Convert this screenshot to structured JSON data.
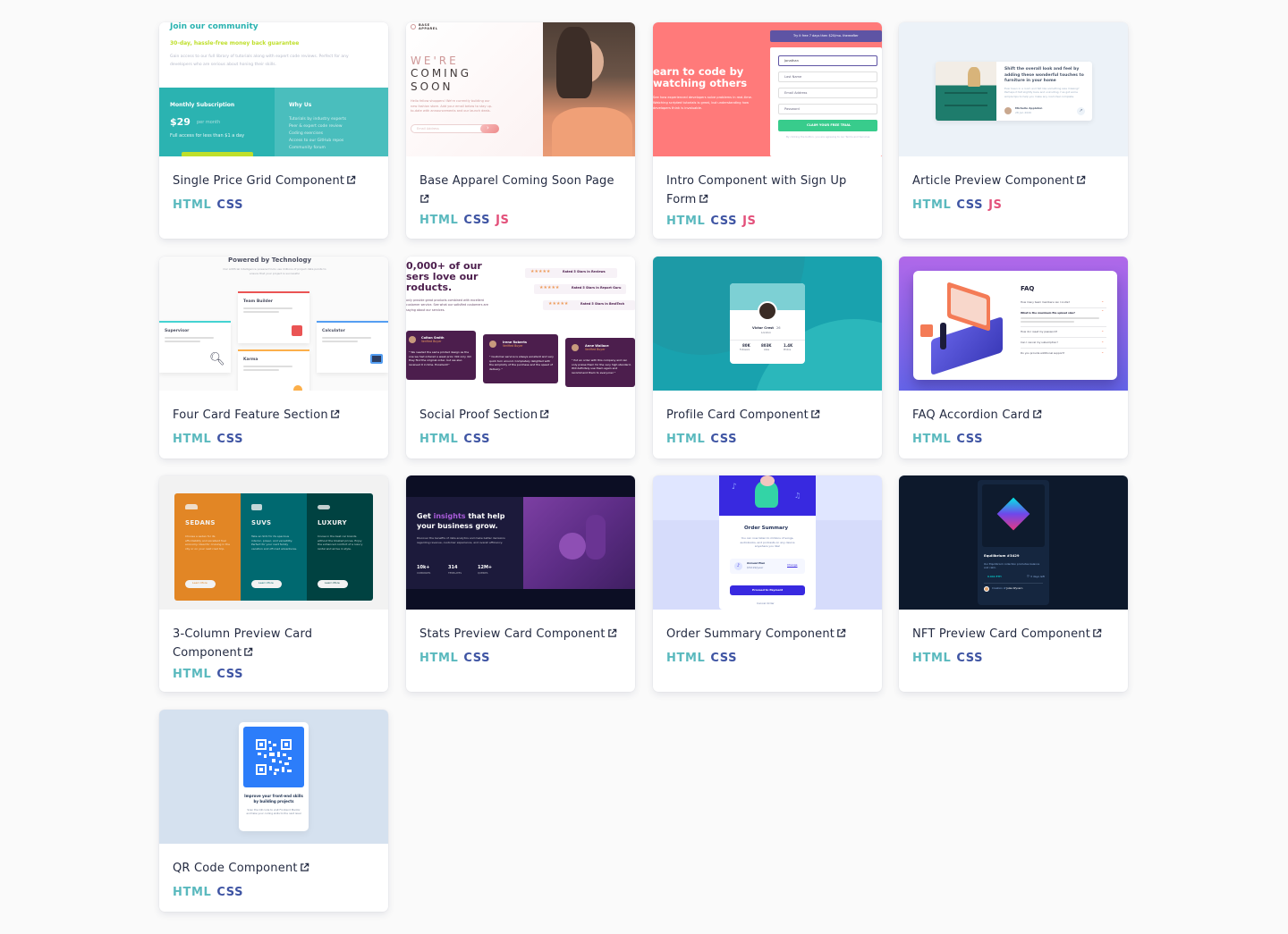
{
  "cards": [
    {
      "title": "Single Price Grid Component",
      "tags": [
        "HTML",
        "CSS"
      ],
      "preview": {
        "heading": "Join our community",
        "subheading": "30-day, hassle-free money back guarantee",
        "text": "Gain access to our full library of tutorials along with expert code reviews. Perfect for any developers who are serious about honing their skills.",
        "subscription_label": "Monthly Subscription",
        "price": "$29",
        "period": "per month",
        "price_note": "Full access for less than $1 a day",
        "why_title": "Why Us",
        "why_items": [
          "Tutorials by industry experts",
          "Peer & expert code review",
          "Coding exercises",
          "Access to our GitHub repos",
          "Community forum"
        ]
      }
    },
    {
      "title": "Base Apparel Coming Soon Page",
      "tags": [
        "HTML",
        "CSS",
        "JS"
      ],
      "preview": {
        "logo": "BASE APPAREL",
        "line1": "WE'RE",
        "line2": "COMING",
        "line3": "SOON",
        "text": "Hello fellow shoppers! We're currently building our new fashion store. Add your email below to stay up-to-date with announcements and our launch deals.",
        "email_placeholder": "Email Address"
      }
    },
    {
      "title": "Intro Component with Sign Up Form",
      "tags": [
        "HTML",
        "CSS",
        "JS"
      ],
      "preview": {
        "headline_line1": "earn to code by",
        "headline_line2": "watching others",
        "text": "See how experienced developers solve problems in real-time. Watching scripted tutorials is great, but understanding how developers think is invaluable.",
        "banner": "Try it free 7 days then $20/mo. thereafter",
        "field_1": "Jonathan",
        "field_2": "Last Name",
        "field_3": "Email Address",
        "field_4": "Password",
        "cta": "CLAIM YOUR FREE TRIAL",
        "terms": "By clicking the button, you are agreeing to our Terms and Services"
      }
    },
    {
      "title": "Article Preview Component",
      "tags": [
        "HTML",
        "CSS",
        "JS"
      ],
      "preview": {
        "headline": "Shift the overall look and feel by adding these wonderful touches to furniture in your home",
        "text": "Ever been in a room and felt like something was missing? Perhaps it felt slightly bare and uninviting. I've got some simple tips to help you make any room feel complete.",
        "author": "Michelle Appleton",
        "date": "28 Jun 2020"
      }
    },
    {
      "title": "Four Card Feature Section",
      "tags": [
        "HTML",
        "CSS"
      ],
      "preview": {
        "heading": "Powered by Technology",
        "text": "Our Artificial Intelligence powered tools use millions of project data points to ensure that your project is successful",
        "feature_1": "Supervisor",
        "feature_2": "Team Builder",
        "feature_3": "Karma",
        "feature_4": "Calculator"
      }
    },
    {
      "title": "Social Proof Section",
      "tags": [
        "HTML",
        "CSS"
      ],
      "preview": {
        "headline_line1": "0,000+ of our",
        "headline_line2": "sers love our",
        "headline_line3": "roducts.",
        "text": "only provide great products combined with excellent customer service. See what our satisfied customers are saying about our services.",
        "rating_1": "Rated 5 Stars in Reviews",
        "rating_2": "Rated 5 Stars in Report Guru",
        "rating_3": "Rated 5 Stars in BestTech",
        "reviewer_1": "Colton Smith",
        "reviewer_2": "Irene Roberts",
        "reviewer_3": "Anne Wallace",
        "verified": "Verified Buyer",
        "quote_1": "\" We needed the same printed design as the one we had ordered a week prior. Not only did they find the original order, but we also received it in time. Excellent!\"",
        "quote_2": "\" Customer service is always excellent and very quick turn around. Completely delighted with the simplicity of the purchase and the speed of delivery. \"",
        "quote_3": "\" Put an order with this company and can only praise them for the very high standard. Will definitely use them again and recommend them to everyone! \""
      }
    },
    {
      "title": "Profile Card Component",
      "tags": [
        "HTML",
        "CSS"
      ],
      "preview": {
        "name": "Victor Crest",
        "age": "26",
        "location": "London",
        "stat_1_value": "80K",
        "stat_1_label": "Followers",
        "stat_2_value": "803K",
        "stat_2_label": "Likes",
        "stat_3_value": "1.4K",
        "stat_3_label": "Photos"
      }
    },
    {
      "title": "FAQ Accordion Card",
      "tags": [
        "HTML",
        "CSS"
      ],
      "preview": {
        "heading": "FAQ",
        "questions": [
          "How many team members can I invite?",
          "What is the maximum file upload size?",
          "How do I reset my password?",
          "Can I cancel my subscription?",
          "Do you provide additional support?"
        ]
      }
    },
    {
      "title": "3-Column Preview Card Component",
      "tags": [
        "HTML",
        "CSS"
      ],
      "preview": {
        "col_1": "SEDANS",
        "col_2": "SUVS",
        "col_3": "LUXURY",
        "text_1": "Choose a sedan for its affordability and excellent fuel economy. Ideal for cruising in the city or on your next road trip.",
        "text_2": "Take an SUV for its spacious interior, power, and versatility. Perfect for your next family vacation and off-road adventures.",
        "text_3": "Cruise in the best car brands without the bloated prices. Enjoy the enhanced comfort of a luxury rental and arrive in style.",
        "button": "Learn More"
      }
    },
    {
      "title": "Stats Preview Card Component",
      "tags": [
        "HTML",
        "CSS"
      ],
      "preview": {
        "headline_1": "Get ",
        "headline_accent": "insights",
        "headline_2": " that help",
        "headline_3": "your business grow.",
        "text": "Discover the benefits of data analytics and make better decisions regarding revenue, customer experience, and overall efficiency.",
        "stat_1_value": "10k+",
        "stat_1_label": "COMPANIES",
        "stat_2_value": "314",
        "stat_2_label": "TEMPLATES",
        "stat_3_value": "12M+",
        "stat_3_label": "QUERIES"
      }
    },
    {
      "title": "Order Summary Component",
      "tags": [
        "HTML",
        "CSS"
      ],
      "preview": {
        "heading": "Order Summary",
        "text": "You can now listen to millions of songs, audiobooks, and podcasts on any device anywhere you like!",
        "plan_name": "Annual Plan",
        "plan_price": "$59.99/year",
        "change": "Change",
        "pay_button": "Proceed to Payment",
        "cancel": "Cancel Order"
      }
    },
    {
      "title": "NFT Preview Card Component",
      "tags": [
        "HTML",
        "CSS"
      ],
      "preview": {
        "name": "Equilibrium #3429",
        "text": "Our Equilibrium collection promotes balance and calm.",
        "price": "0.041 ETH",
        "time_left": "3 days left",
        "creator_prefix": "Creation of ",
        "creator": "Jules Wyvern"
      }
    },
    {
      "title": "QR Code Component",
      "tags": [
        "HTML",
        "CSS"
      ],
      "preview": {
        "heading": "Improve your front-end skills by building projects",
        "text": "Scan the QR code to visit Frontend Mentor and take your coding skills to the next level"
      }
    }
  ]
}
